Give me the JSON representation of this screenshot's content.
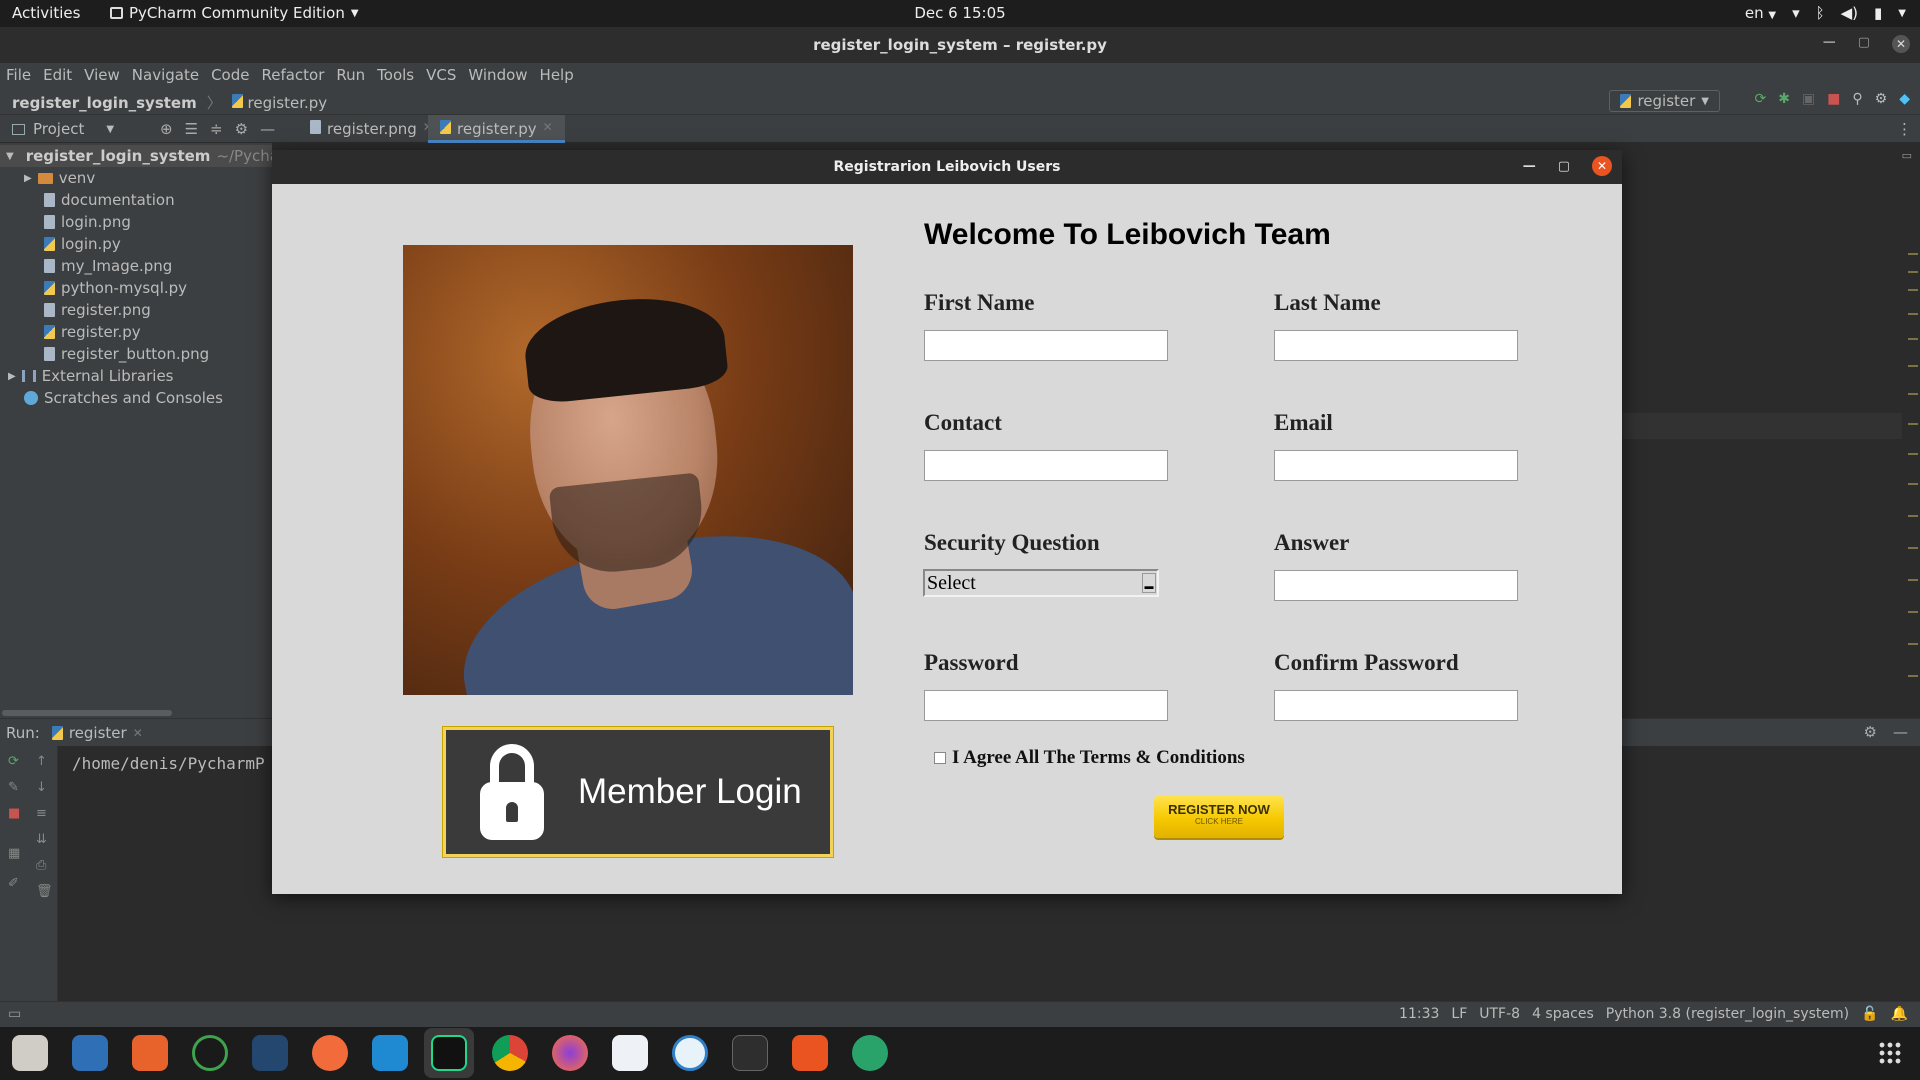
{
  "topbar": {
    "activities": "Activities",
    "app_name": "PyCharm Community Edition",
    "clock": "Dec 6  15:05",
    "lang": "en"
  },
  "window": {
    "title": "register_login_system – register.py"
  },
  "menu": [
    "File",
    "Edit",
    "View",
    "Navigate",
    "Code",
    "Refactor",
    "Run",
    "Tools",
    "VCS",
    "Window",
    "Help"
  ],
  "navbar": {
    "project": "register_login_system",
    "file": "register.py",
    "run_config": "register"
  },
  "toolrow": {
    "project_label": "Project",
    "tabs": [
      {
        "label": "register.png",
        "active": false
      },
      {
        "label": "register.py",
        "active": true
      }
    ]
  },
  "project_tree": {
    "root": "register_login_system",
    "root_path": "~/Pycharm",
    "items": [
      "venv",
      "documentation",
      "login.png",
      "login.py",
      "my_Image.png",
      "python-mysql.py",
      "register.png",
      "register.py",
      "register_button.png"
    ],
    "external": "External Libraries",
    "scratches": "Scratches and Consoles"
  },
  "run_panel": {
    "label": "Run:",
    "tab": "register",
    "output": "/home/denis/PycharmP"
  },
  "statusbar": {
    "position": "11:33",
    "line_sep": "LF",
    "encoding": "UTF-8",
    "indent": "4 spaces",
    "interpreter": "Python 3.8 (register_login_system)"
  },
  "tk_window": {
    "title": "Registrarion Leibovich Users",
    "welcome": "Welcome To Leibovich Team",
    "member_login": "Member Login",
    "fields": {
      "first_name": "First Name",
      "last_name": "Last Name",
      "contact": "Contact",
      "email": "Email",
      "security_question": "Security Question",
      "answer": "Answer",
      "password": "Password",
      "confirm_password": "Confirm Password"
    },
    "select_value": "Select",
    "agree": "I Agree All The Terms & Conditions",
    "register_button": "REGISTER NOW",
    "register_sub": "CLICK HERE"
  },
  "colors": {
    "ide_bg": "#2b2b2b",
    "panel": "#3c3f41",
    "tk_bg": "#d9d9d9",
    "accent_yellow": "#f5c800",
    "close_orange": "#e95420"
  }
}
